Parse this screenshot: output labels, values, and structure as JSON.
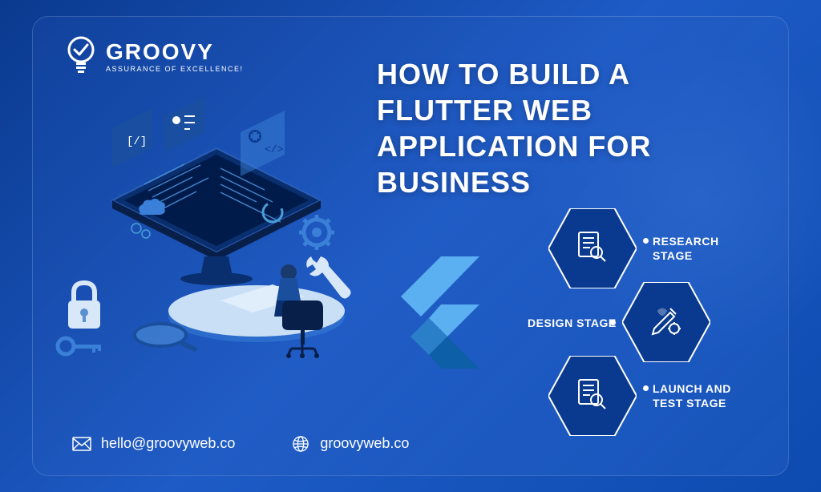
{
  "logo": {
    "name": "GROOVY",
    "tagline": "ASSURANCE OF EXCELLENCE!"
  },
  "title": "HOW TO BUILD A FLUTTER WEB APPLICATION FOR BUSINESS",
  "stages": [
    {
      "label": "RESEARCH STAGE"
    },
    {
      "label": "DESIGN STAGE"
    },
    {
      "label": "LAUNCH AND TEST STAGE"
    }
  ],
  "contact": {
    "email": "hello@groovyweb.co",
    "website": "groovyweb.co"
  }
}
